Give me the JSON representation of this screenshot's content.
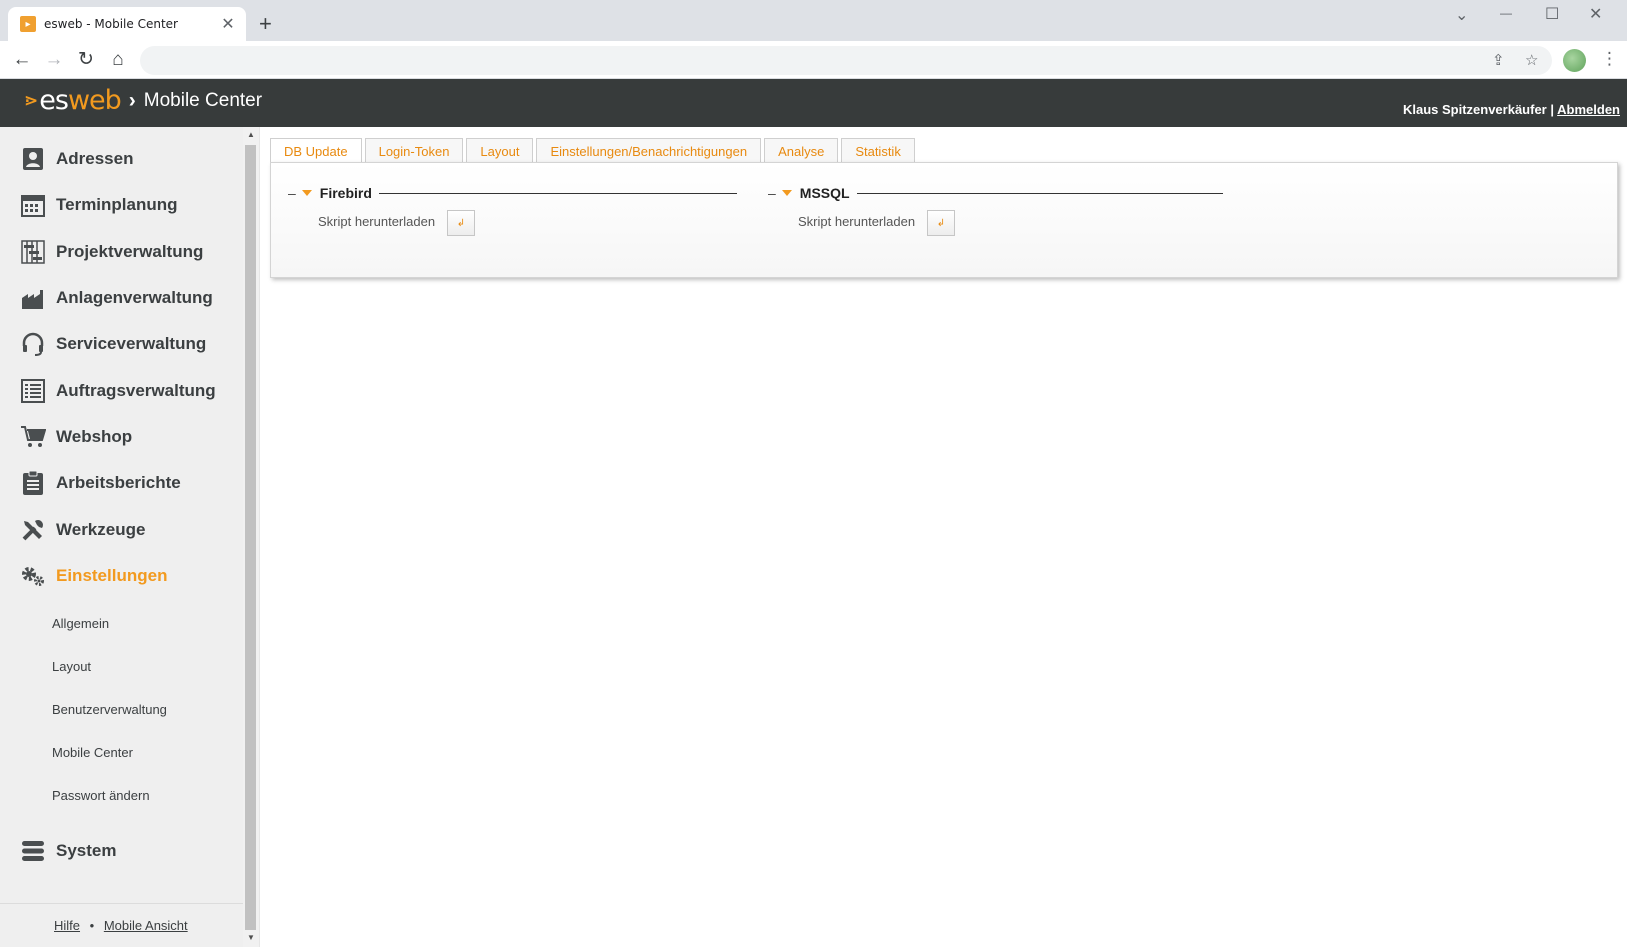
{
  "browser": {
    "tab_title": "esweb - Mobile Center",
    "new_tab": "+",
    "minimize": "—",
    "maximize": "☐",
    "close": "✕",
    "tablist": "⌄"
  },
  "header": {
    "logo_es": "es",
    "logo_web": "web",
    "app_title": "Mobile Center",
    "user_name": "Klaus Spitzenverkäufer",
    "separator": "|",
    "logout": "Abmelden"
  },
  "sidebar": {
    "items": [
      {
        "label": "Adressen",
        "icon": "address-book-icon"
      },
      {
        "label": "Terminplanung",
        "icon": "calendar-icon"
      },
      {
        "label": "Projektverwaltung",
        "icon": "gantt-icon"
      },
      {
        "label": "Anlagenverwaltung",
        "icon": "factory-icon"
      },
      {
        "label": "Serviceverwaltung",
        "icon": "headset-icon"
      },
      {
        "label": "Auftragsverwaltung",
        "icon": "list-icon"
      },
      {
        "label": "Webshop",
        "icon": "cart-icon"
      },
      {
        "label": "Arbeitsberichte",
        "icon": "clipboard-icon"
      },
      {
        "label": "Werkzeuge",
        "icon": "tools-icon"
      },
      {
        "label": "Einstellungen",
        "icon": "gears-icon"
      }
    ],
    "sub_items": [
      "Allgemein",
      "Layout",
      "Benutzerverwaltung",
      "Mobile Center",
      "Passwort ändern"
    ],
    "system": {
      "label": "System",
      "icon": "database-icon"
    },
    "footer": {
      "help": "Hilfe",
      "dot": "•",
      "mobile": "Mobile Ansicht"
    }
  },
  "main": {
    "tabs": [
      "DB Update",
      "Login-Token",
      "Layout",
      "Einstellungen/Benachrichtigungen",
      "Analyse",
      "Statistik"
    ],
    "active_tab": "DB Update",
    "groups": [
      {
        "title": "Firebird",
        "download_label": "Skript herunterladen"
      },
      {
        "title": "MSSQL",
        "download_label": "Skript herunterladen"
      }
    ]
  },
  "colors": {
    "accent": "#f29a1f",
    "header_bg": "#373b3b",
    "sidebar_bg": "#efefef"
  }
}
